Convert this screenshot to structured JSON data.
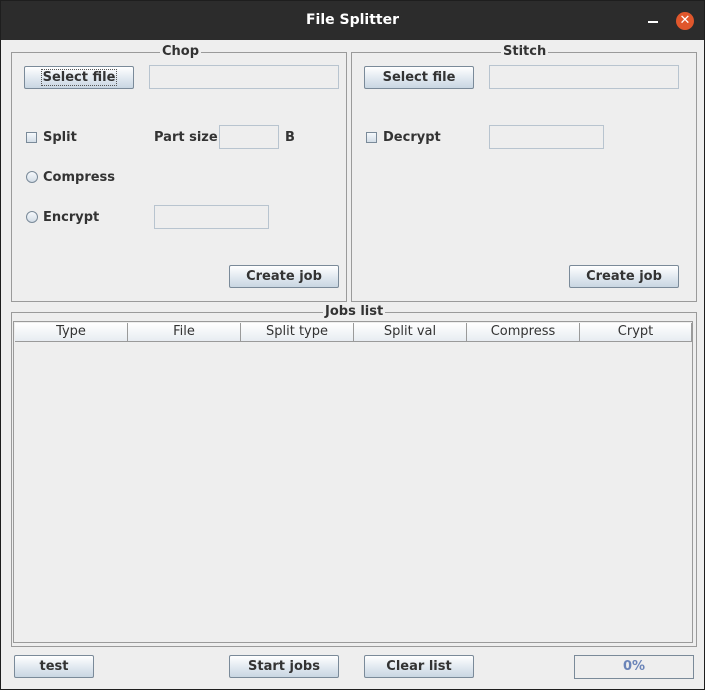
{
  "window": {
    "title": "File Splitter"
  },
  "chop": {
    "legend": "Chop",
    "select_file_label": "Select file",
    "file_path_value": "",
    "split_label": "Split",
    "part_size_label": "Part size",
    "part_size_value": "",
    "part_size_unit": "B",
    "compress_label": "Compress",
    "encrypt_label": "Encrypt",
    "encrypt_value": "",
    "create_job_label": "Create job"
  },
  "stitch": {
    "legend": "Stitch",
    "select_file_label": "Select file",
    "file_path_value": "",
    "decrypt_label": "Decrypt",
    "decrypt_value": "",
    "create_job_label": "Create job"
  },
  "jobs": {
    "legend": "Jobs list",
    "columns": [
      "Type",
      "File",
      "Split type",
      "Split val",
      "Compress",
      "Crypt"
    ],
    "rows": []
  },
  "footer": {
    "test_label": "test",
    "start_jobs_label": "Start jobs",
    "clear_list_label": "Clear list",
    "progress_text": "0%",
    "progress_value": 0
  }
}
